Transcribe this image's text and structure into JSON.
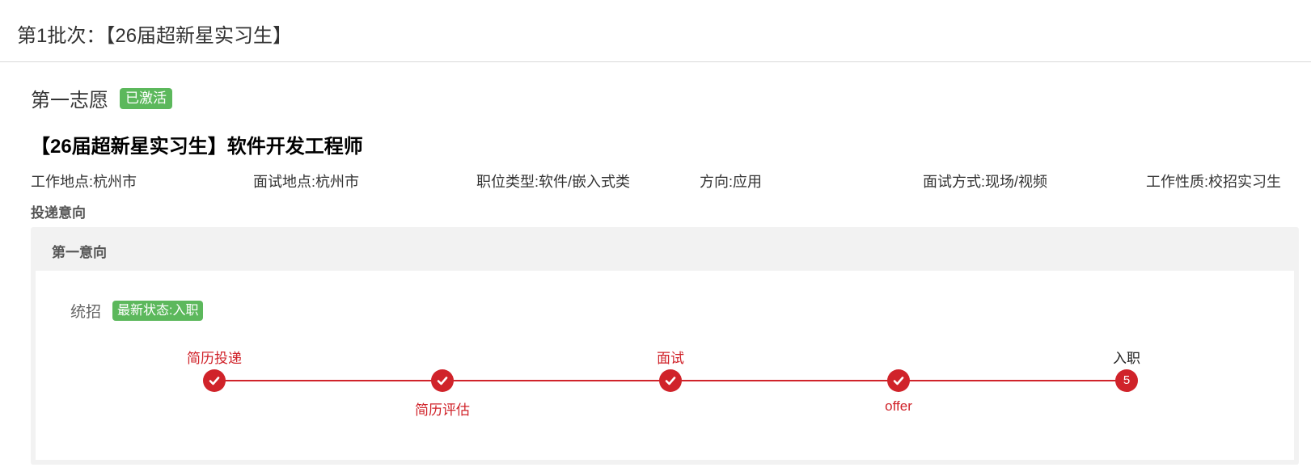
{
  "batch": {
    "title": "第1批次：【26届超新星实习生】"
  },
  "preference": {
    "title": "第一志愿",
    "status_badge": "已激活",
    "badge_color": "#5cb85c"
  },
  "job": {
    "title": "【26届超新星实习生】软件开发工程师",
    "info": [
      "工作地点:杭州市",
      "面试地点:杭州市",
      "职位类型:软件/嵌入式类",
      "方向:应用",
      "面试方式:现场/视频",
      "工作性质:校招实习生"
    ]
  },
  "intent": {
    "section_label": "投递意向",
    "panel_title": "第一意向",
    "recruit_type": "统招",
    "latest_status": "最新状态:入职",
    "accent_color": "#d0232a",
    "steps": [
      {
        "label": "简历投递",
        "state": "done",
        "icon": "check-icon"
      },
      {
        "label": "简历评估",
        "state": "done",
        "icon": "check-icon"
      },
      {
        "label": "面试",
        "state": "done",
        "icon": "check-icon"
      },
      {
        "label": "offer",
        "state": "done",
        "icon": "check-icon"
      },
      {
        "label": "入职",
        "state": "current",
        "number": "5"
      }
    ]
  }
}
